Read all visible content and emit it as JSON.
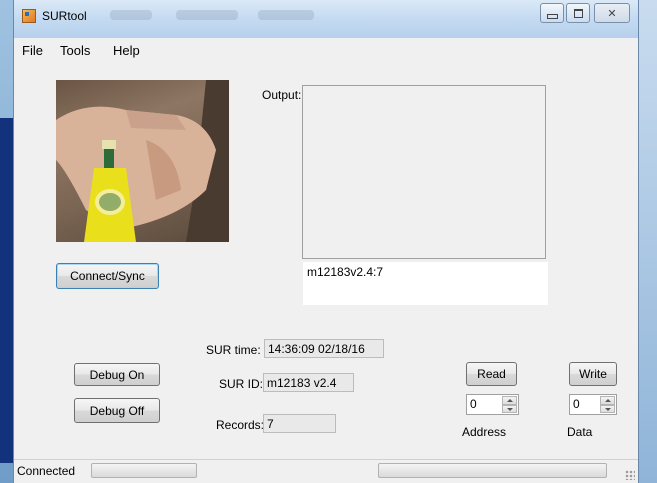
{
  "window": {
    "title": "SURtool"
  },
  "menu": {
    "items": [
      "File",
      "Tools",
      "Help"
    ]
  },
  "main": {
    "output_label": "Output:",
    "output_text": "",
    "input_value": "m12183v2.4:7",
    "connect_label": "Connect/Sync",
    "sur_time_label": "SUR time:",
    "sur_time_value": "14:36:09 02/18/16",
    "sur_id_label": "SUR ID:",
    "sur_id_value": "m12183 v2.4",
    "records_label": "Records:",
    "records_value": "7",
    "debug_on_label": "Debug On",
    "debug_off_label": "Debug Off",
    "read_label": "Read",
    "write_label": "Write",
    "address_value": "0",
    "address_label": "Address",
    "data_value": "0",
    "data_label": "Data"
  },
  "status": {
    "text": "Connected",
    "progress_fraction": 0,
    "progress2_fraction": 0
  },
  "colors": {
    "window_bg": "#f0f0f0",
    "titlebar": "#c4daf1",
    "button_focus": "#3c7fb1"
  },
  "icons": [
    "app-icon",
    "minimize-icon",
    "maximize-icon",
    "close-icon",
    "spin-up-icon",
    "spin-down-icon",
    "resize-grip-icon"
  ]
}
